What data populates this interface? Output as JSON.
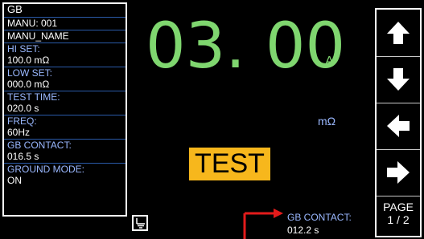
{
  "left_panel": {
    "mode": "GB",
    "manu_label": "MANU: 001",
    "manu_name": "MANU_NAME",
    "hi_set_label": "HI SET:",
    "hi_set_value": "100.0 mΩ",
    "low_set_label": "LOW SET:",
    "low_set_value": "000.0 mΩ",
    "test_time_label": "TEST TIME:",
    "test_time_value": "020.0 s",
    "freq_label": "FREQ:",
    "freq_value": "60Hz",
    "gb_contact_label": "GB CONTACT:",
    "gb_contact_value": "016.5 s",
    "ground_mode_label": "GROUND MODE:",
    "ground_mode_value": "ON"
  },
  "main": {
    "reading": "03. 00",
    "reading_unit": "A",
    "resistance_unit": "mΩ",
    "status": "TEST"
  },
  "bottom": {
    "gb_contact_label": "GB CONTACT:",
    "gb_contact_value": "012.2 s"
  },
  "nav": {
    "page_label": "PAGE",
    "page_number": "1 / 2"
  },
  "colors": {
    "reading": "#7fd66f",
    "label": "#9ab8ff",
    "status_bg": "#f7b71c",
    "arrow": "#e31b1b"
  }
}
